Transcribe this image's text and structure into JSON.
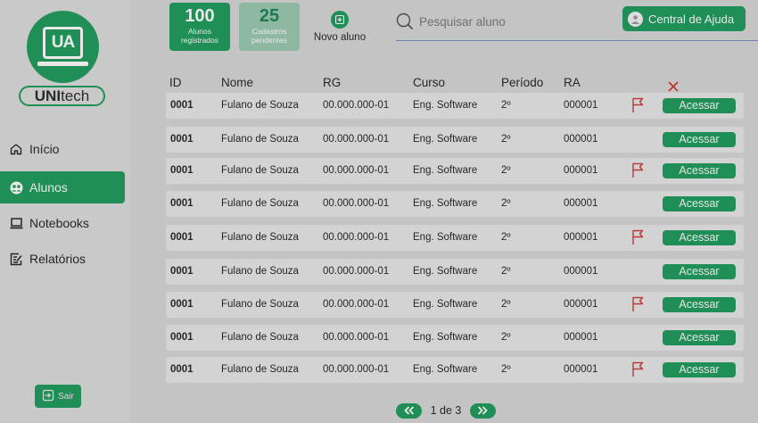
{
  "brand": {
    "logo_text": "UA",
    "name_bold": "UNI",
    "name_rest": "tech"
  },
  "nav": {
    "items": [
      {
        "label": "Início",
        "icon": "home-icon"
      },
      {
        "label": "Alunos",
        "icon": "students-icon"
      },
      {
        "label": "Notebooks",
        "icon": "laptop-icon"
      },
      {
        "label": "Relatórios",
        "icon": "report-icon"
      }
    ],
    "logout_label": "Sair"
  },
  "stats": {
    "registered": {
      "value": "100",
      "label_line1": "Alunos",
      "label_line2": "registrados"
    },
    "pending": {
      "value": "25",
      "label_line1": "Cadastros",
      "label_line2": "pendentes"
    }
  },
  "new_student_label": "Novo aluno",
  "search": {
    "placeholder": "Pesquisar aluno"
  },
  "help_label": "Central de Ajuda",
  "table": {
    "columns": [
      "ID",
      "Nome",
      "RG",
      "Curso",
      "Período",
      "RA"
    ],
    "access_label": "Acessar",
    "rows": [
      {
        "id": "0001",
        "nome": "Fulano de Souza",
        "rg": "00.000.000-01",
        "curso": "Eng. Software",
        "periodo": "2º",
        "ra": "000001",
        "flagged": true
      },
      {
        "id": "0001",
        "nome": "Fulano de Souza",
        "rg": "00.000.000-01",
        "curso": "Eng. Software",
        "periodo": "2º",
        "ra": "000001",
        "flagged": false
      },
      {
        "id": "0001",
        "nome": "Fulano de Souza",
        "rg": "00.000.000-01",
        "curso": "Eng. Software",
        "periodo": "2º",
        "ra": "000001",
        "flagged": true
      },
      {
        "id": "0001",
        "nome": "Fulano de Souza",
        "rg": "00.000.000-01",
        "curso": "Eng. Software",
        "periodo": "2º",
        "ra": "000001",
        "flagged": false
      },
      {
        "id": "0001",
        "nome": "Fulano de Souza",
        "rg": "00.000.000-01",
        "curso": "Eng. Software",
        "periodo": "2º",
        "ra": "000001",
        "flagged": true
      },
      {
        "id": "0001",
        "nome": "Fulano de Souza",
        "rg": "00.000.000-01",
        "curso": "Eng. Software",
        "periodo": "2º",
        "ra": "000001",
        "flagged": false
      },
      {
        "id": "0001",
        "nome": "Fulano de Souza",
        "rg": "00.000.000-01",
        "curso": "Eng. Software",
        "periodo": "2º",
        "ra": "000001",
        "flagged": true
      },
      {
        "id": "0001",
        "nome": "Fulano de Souza",
        "rg": "00.000.000-01",
        "curso": "Eng. Software",
        "periodo": "2º",
        "ra": "000001",
        "flagged": false
      },
      {
        "id": "0001",
        "nome": "Fulano de Souza",
        "rg": "00.000.000-01",
        "curso": "Eng. Software",
        "periodo": "2º",
        "ra": "000001",
        "flagged": true
      }
    ]
  },
  "pagination": {
    "text": "1 de 3"
  },
  "colors": {
    "brand_green": "#1f8f57",
    "flag_red": "#b83a3a",
    "background": "#c4c4c4"
  }
}
